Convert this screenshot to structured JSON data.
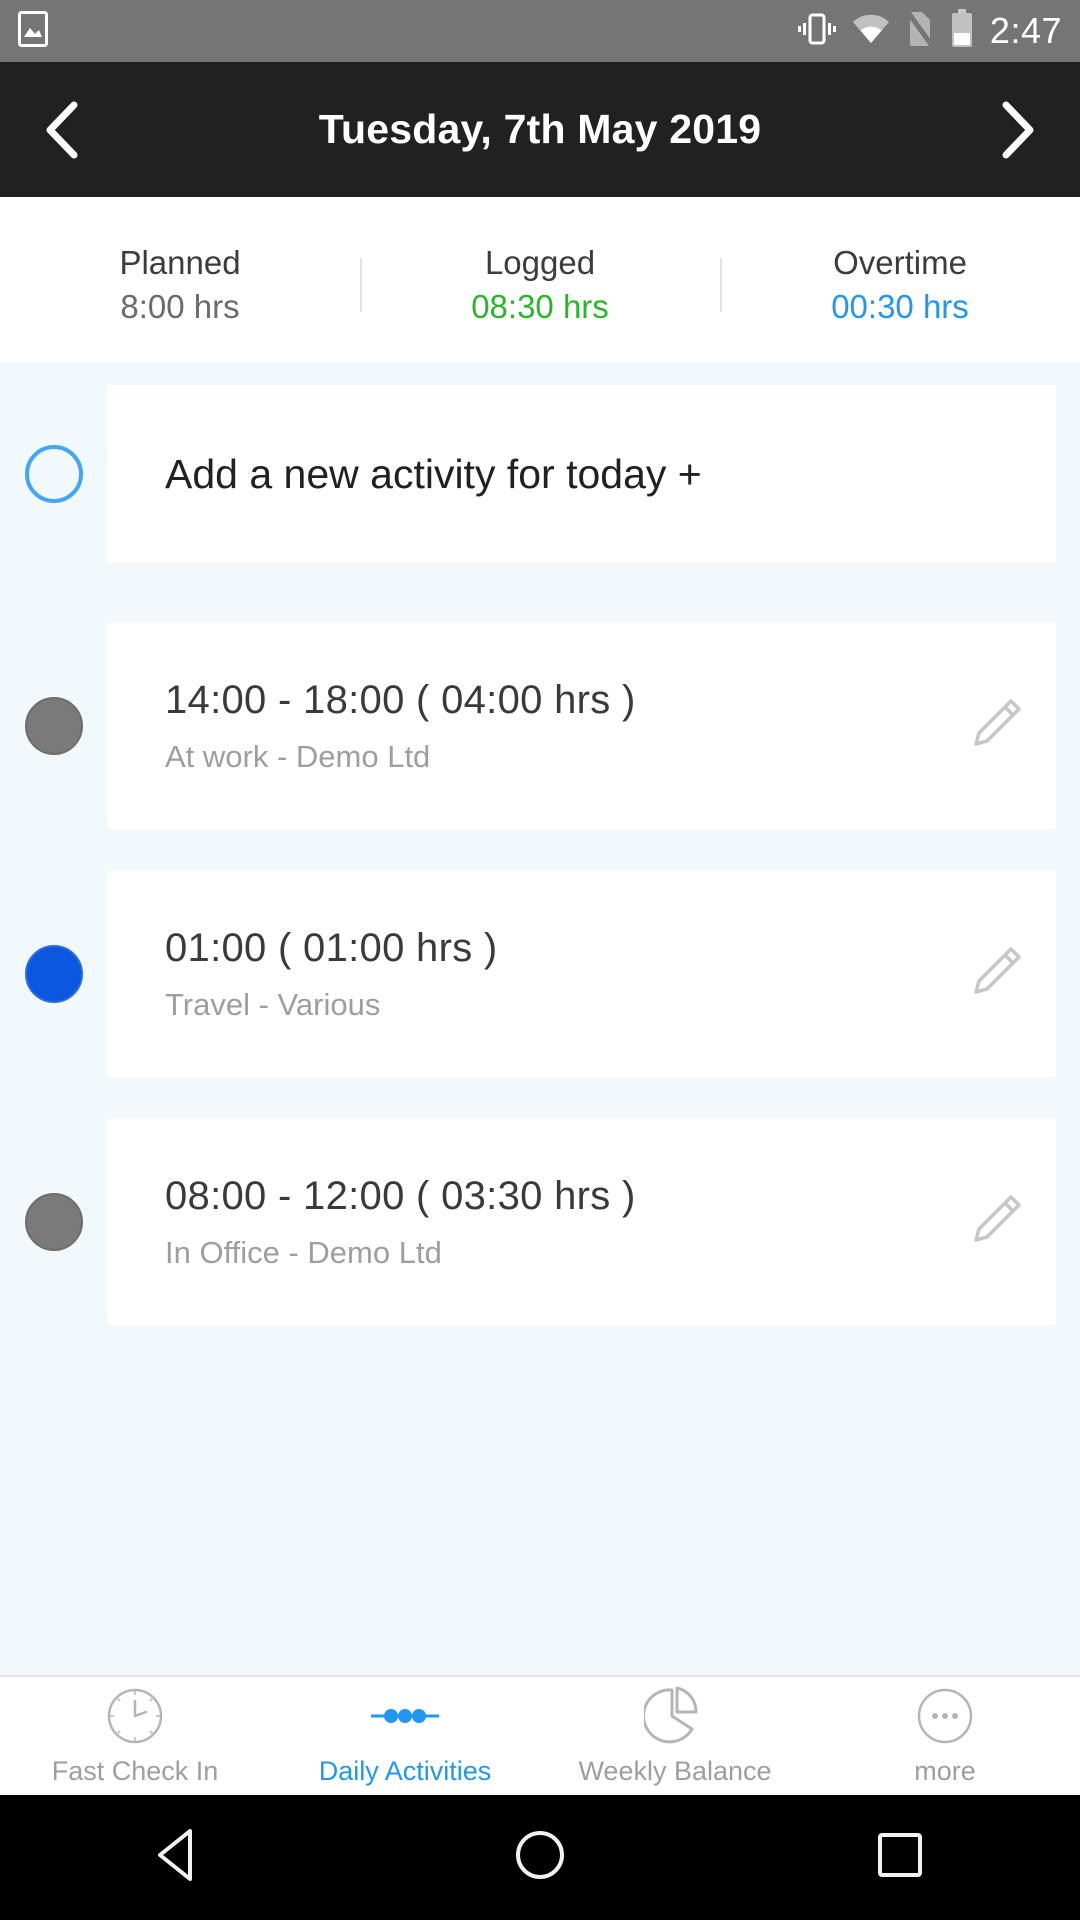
{
  "status_bar": {
    "time": "2:47",
    "left_icons": [
      "image-icon"
    ],
    "right_icons": [
      "vibrate-icon",
      "wifi-icon",
      "no-sim-icon",
      "battery-icon"
    ]
  },
  "header": {
    "prev_label": "‹",
    "title": "Tuesday, 7th May 2019",
    "next_label": "›"
  },
  "summary": {
    "columns": [
      {
        "label": "Planned",
        "value": "8:00 hrs",
        "color": "#6b6b6b"
      },
      {
        "label": "Logged",
        "value": "08:30 hrs",
        "color": "#2ab62a"
      },
      {
        "label": "Overtime",
        "value": "00:30 hrs",
        "color": "#2196f3"
      }
    ]
  },
  "add_activity": {
    "text": "Add a new activity for today +",
    "dot_style": "outline-blue"
  },
  "activities": [
    {
      "time": "14:00 - 18:00 ( 04:00 hrs )",
      "description": "At work - Demo Ltd",
      "dot_color": "#7a7a7a",
      "edit_icon": "pencil-icon"
    },
    {
      "time": "01:00 ( 01:00 hrs )",
      "description": "Travel - Various",
      "dot_color": "#0b57e0",
      "edit_icon": "pencil-icon"
    },
    {
      "time": "08:00 - 12:00 ( 03:30 hrs )",
      "description": "In Office - Demo Ltd",
      "dot_color": "#7a7a7a",
      "edit_icon": "pencil-icon"
    }
  ],
  "bottom_nav": {
    "active_index": 1,
    "items": [
      {
        "label": "Fast Check In",
        "icon": "clock-icon"
      },
      {
        "label": "Daily Activities",
        "icon": "timeline-dots-icon"
      },
      {
        "label": "Weekly Balance",
        "icon": "pie-chart-icon"
      },
      {
        "label": "more",
        "icon": "more-circle-icon"
      }
    ]
  },
  "android_nav": {
    "back": "back-triangle-icon",
    "home": "home-circle-icon",
    "recents": "recents-square-icon"
  },
  "colors": {
    "accent_blue": "#2196f3",
    "green": "#2ab62a",
    "header_dark": "#212121",
    "list_bg": "#f2f9fc",
    "status_bg": "#757575"
  }
}
